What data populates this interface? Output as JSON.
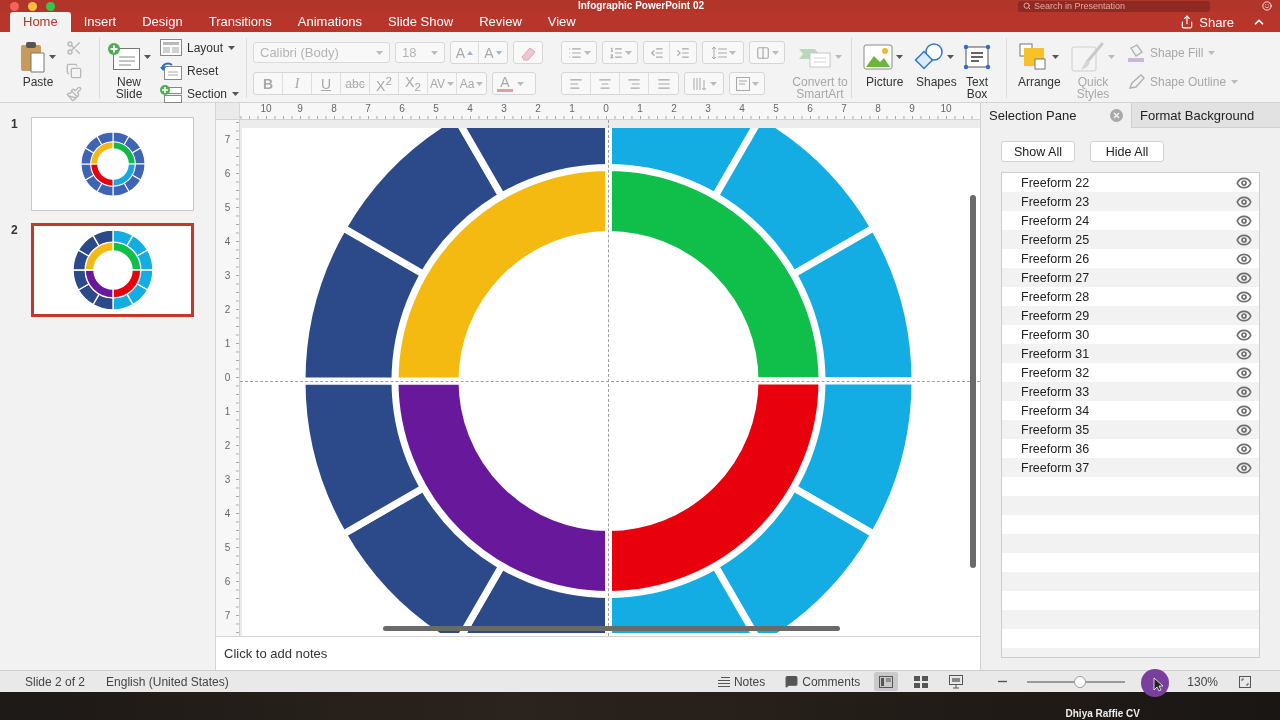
{
  "window": {
    "title": "Infographic PowerPoint 02",
    "search_placeholder": "Search in Presentation"
  },
  "tabs": [
    {
      "label": "Home",
      "selected": true
    },
    {
      "label": "Insert",
      "selected": false
    },
    {
      "label": "Design",
      "selected": false
    },
    {
      "label": "Transitions",
      "selected": false
    },
    {
      "label": "Animations",
      "selected": false
    },
    {
      "label": "Slide Show",
      "selected": false
    },
    {
      "label": "Review",
      "selected": false
    },
    {
      "label": "View",
      "selected": false
    }
  ],
  "share": "Share",
  "ribbon": {
    "clipboard": {
      "paste": "Paste",
      "tools": [
        {
          "kind": "cut",
          "disabled": true
        },
        {
          "kind": "copy",
          "disabled": true
        },
        {
          "kind": "painter",
          "disabled": true
        }
      ]
    },
    "slides": {
      "new_slide": "New Slide",
      "commands": [
        {
          "label": "Layout",
          "kind": "layout",
          "dropdown": true
        },
        {
          "label": "Reset",
          "kind": "reset",
          "dropdown": false
        },
        {
          "label": "Section",
          "kind": "section",
          "dropdown": true
        }
      ]
    },
    "font": {
      "disabled": true,
      "family": "Calibri (Body)",
      "size": "18",
      "size_buttons": [
        {
          "label": "A",
          "kind": "grow"
        },
        {
          "label": "A",
          "kind": "shrink"
        }
      ],
      "style_buttons": [
        {
          "label": "B",
          "kind": "bold"
        },
        {
          "label": "I",
          "kind": "italic"
        },
        {
          "label": "U",
          "kind": "underline"
        },
        {
          "label": "abc",
          "kind": "strikethrough"
        },
        {
          "label": "X$^{2}$",
          "kind": "superscript"
        },
        {
          "label": "X$_{2}$",
          "kind": "subscript"
        },
        {
          "label": "AV",
          "kind": "spacing"
        },
        {
          "label": "Aa",
          "kind": "case"
        }
      ],
      "color_button": "A"
    },
    "paragraph": {
      "disabled": true,
      "convert": "Convert to SmartArt"
    },
    "insert": [
      {
        "label": "Picture",
        "kind": "picture"
      },
      {
        "label": "Shapes",
        "kind": "shapes"
      },
      {
        "label": "Text Box",
        "kind": "textbox"
      }
    ],
    "arrange": [
      {
        "label": "Arrange",
        "kind": "arrange",
        "disabled": false
      },
      {
        "label": "Quick Styles",
        "kind": "styles",
        "disabled": true
      }
    ],
    "shape_format": [
      {
        "label": "Shape Fill",
        "kind": "fill",
        "disabled": true
      },
      {
        "label": "Shape Outline",
        "kind": "outline",
        "disabled": true
      }
    ]
  },
  "slides": [
    {
      "number": "1",
      "selected": false
    },
    {
      "number": "2",
      "selected": true
    }
  ],
  "ruler": {
    "horizontal": [
      "10",
      "9",
      "8",
      "7",
      "6",
      "5",
      "4",
      "3",
      "2",
      "1",
      "0",
      "1",
      "2",
      "3",
      "4",
      "5",
      "6",
      "7",
      "8",
      "9",
      "10"
    ],
    "vertical": [
      "7",
      "6",
      "5",
      "4",
      "3",
      "2",
      "1",
      "0",
      "1",
      "2",
      "3",
      "4",
      "5",
      "6",
      "7"
    ]
  },
  "notes": {
    "placeholder": "Click to add notes"
  },
  "selection_pane": {
    "tabs": [
      {
        "label": "Selection Pane",
        "selected": true
      },
      {
        "label": "Format Background",
        "selected": false
      }
    ],
    "buttons": [
      "Show All",
      "Hide All"
    ],
    "items": [
      {
        "name": "Freeform 22",
        "visible": true
      },
      {
        "name": "Freeform 23",
        "visible": true
      },
      {
        "name": "Freeform 24",
        "visible": true
      },
      {
        "name": "Freeform 25",
        "visible": true
      },
      {
        "name": "Freeform 26",
        "visible": true
      },
      {
        "name": "Freeform 27",
        "visible": true
      },
      {
        "name": "Freeform 28",
        "visible": true
      },
      {
        "name": "Freeform 29",
        "visible": true
      },
      {
        "name": "Freeform 30",
        "visible": true
      },
      {
        "name": "Freeform 31",
        "visible": true
      },
      {
        "name": "Freeform 32",
        "visible": true
      },
      {
        "name": "Freeform 33",
        "visible": true
      },
      {
        "name": "Freeform 34",
        "visible": true
      },
      {
        "name": "Freeform 35",
        "visible": true
      },
      {
        "name": "Freeform 36",
        "visible": true
      },
      {
        "name": "Freeform 37",
        "visible": true
      }
    ]
  },
  "status_bar": {
    "slide": "Slide 2 of 2",
    "language": "English (United States)",
    "notes": "Notes",
    "comments": "Comments",
    "views": [
      {
        "kind": "normal",
        "selected": true
      },
      {
        "kind": "sorter",
        "selected": false
      },
      {
        "kind": "reading",
        "selected": false
      }
    ],
    "zoom": {
      "level": 0.54,
      "reading": "130%"
    }
  },
  "desktop": {
    "label": "Dhiya Raffie CV"
  }
}
